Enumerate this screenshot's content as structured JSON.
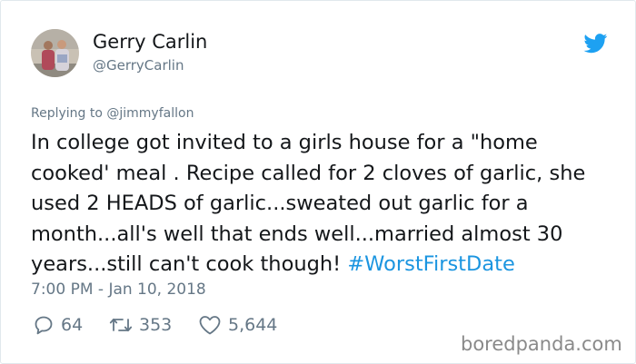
{
  "author": {
    "name": "Gerry Carlin",
    "handle": "@GerryCarlin"
  },
  "tweet": {
    "reply_to": "Replying to @jimmyfallon",
    "text": "In college got invited to a girls house for a \"home cooked' meal . Recipe called for 2 cloves of garlic, she used 2 HEADS of garlic...sweated out garlic for a month...all's well that ends well...married almost 30 years...still can't cook though! ",
    "hashtag": "#WorstFirstDate",
    "timestamp": "7:00 PM - Jan 10, 2018"
  },
  "actions": {
    "replies": "64",
    "retweets": "353",
    "likes": "5,644"
  },
  "icons": {
    "avatar": "avatar",
    "logo": "twitter-bird-icon",
    "reply": "reply-icon",
    "retweet": "retweet-icon",
    "like": "heart-icon"
  },
  "colors": {
    "brand": "#1da1f2",
    "hashtag": "#1b95e0",
    "secondary_text": "#657786",
    "primary_text": "#14171a"
  },
  "watermark": "boredpanda.com"
}
